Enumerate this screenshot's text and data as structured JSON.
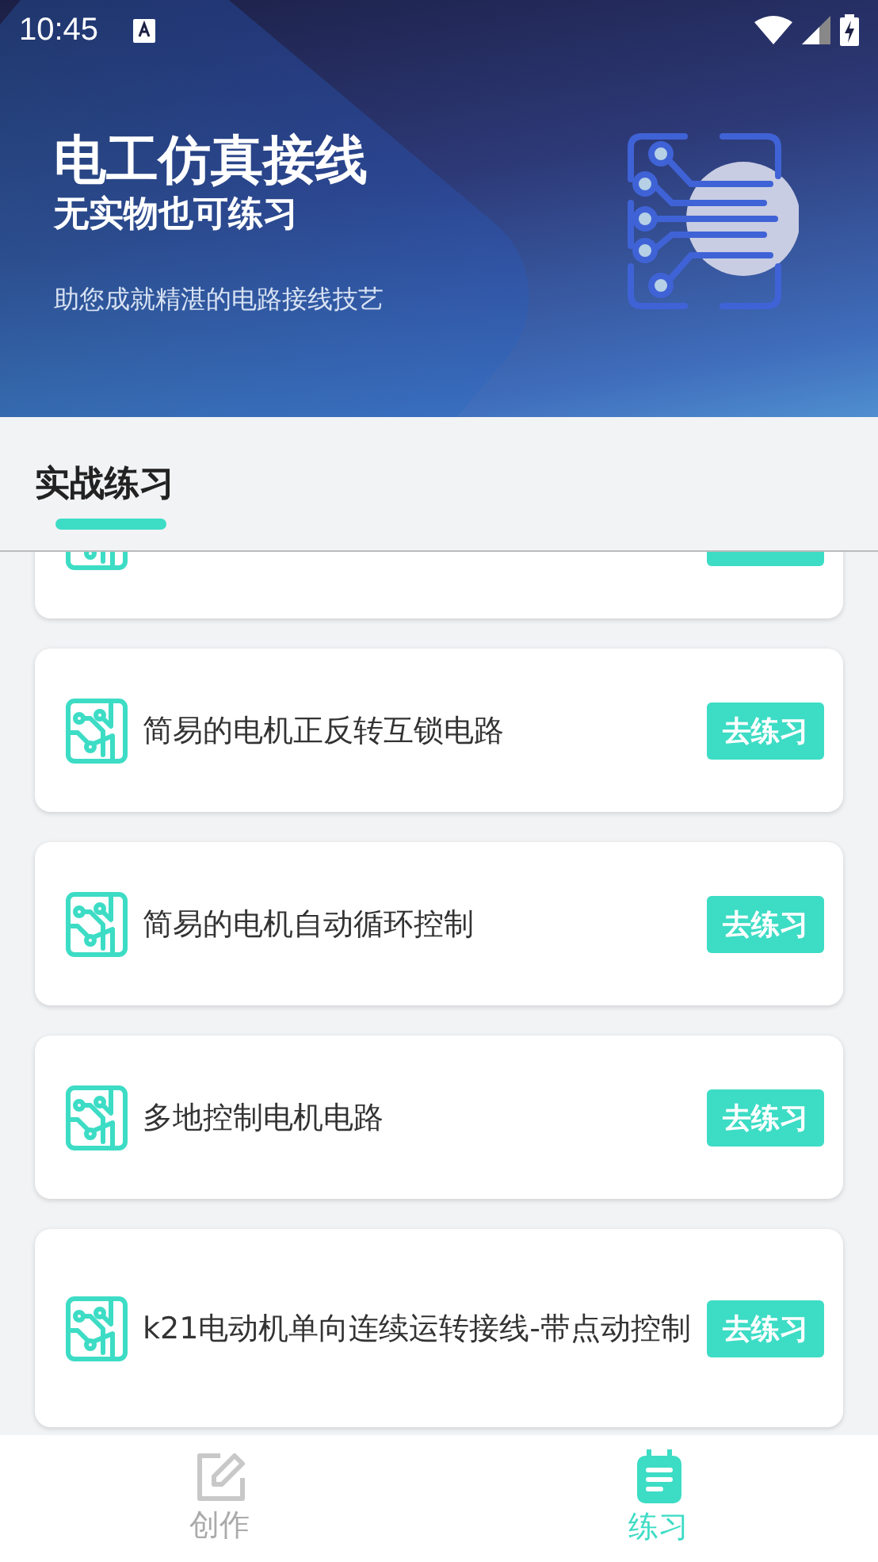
{
  "status_bar": {
    "time": "10:45"
  },
  "banner": {
    "title": "电工仿真接线",
    "subtitle": "无实物也可练习",
    "tagline": "助您成就精湛的电路接线技艺"
  },
  "section": {
    "title": "实战练习"
  },
  "exercises": [
    {
      "kind": "clipped"
    },
    {
      "kind": "full",
      "title": "简易的电机正反转互锁电路",
      "button": "去练习"
    },
    {
      "kind": "full",
      "title": "简易的电机自动循环控制",
      "button": "去练习"
    },
    {
      "kind": "full",
      "title": "多地控制电机电路",
      "button": "去练习"
    },
    {
      "kind": "full",
      "title": "k21电动机单向连续运转接线-带点动控制",
      "button": "去练习"
    }
  ],
  "tab_bar": [
    {
      "kind": "create",
      "label": "创作",
      "selected": false
    },
    {
      "kind": "practice",
      "label": "练习",
      "selected": true
    }
  ]
}
